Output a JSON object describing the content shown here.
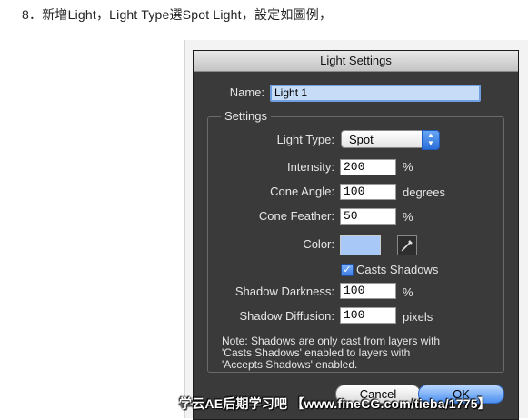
{
  "caption": "8．新增Light，Light Type選Spot Light，設定如圖例，",
  "dialog": {
    "title": "Light Settings",
    "name_label": "Name:",
    "name_value": "Light 1",
    "group_title": "Settings",
    "light_type_label": "Light Type:",
    "light_type_value": "Spot",
    "intensity_label": "Intensity:",
    "intensity_value": "200",
    "intensity_unit": "%",
    "cone_angle_label": "Cone Angle:",
    "cone_angle_value": "100",
    "cone_angle_unit": "degrees",
    "cone_feather_label": "Cone Feather:",
    "cone_feather_value": "50",
    "cone_feather_unit": "%",
    "color_label": "Color:",
    "color_value": "#a8c8f8",
    "casts_shadows_label": "Casts Shadows",
    "casts_shadows_checked": true,
    "shadow_darkness_label": "Shadow Darkness:",
    "shadow_darkness_value": "100",
    "shadow_darkness_unit": "%",
    "shadow_diffusion_label": "Shadow Diffusion:",
    "shadow_diffusion_value": "100",
    "shadow_diffusion_unit": "pixels",
    "note_line1": "Note: Shadows are only cast from layers with",
    "note_line2": "'Casts Shadows'  enabled to layers with",
    "note_line3": "'Accepts Shadows'  enabled.",
    "cancel_label": "Cancel",
    "ok_label": "OK"
  },
  "watermark": "学云AE后期学习吧 【www.fineCG.com/tieba/1775】"
}
